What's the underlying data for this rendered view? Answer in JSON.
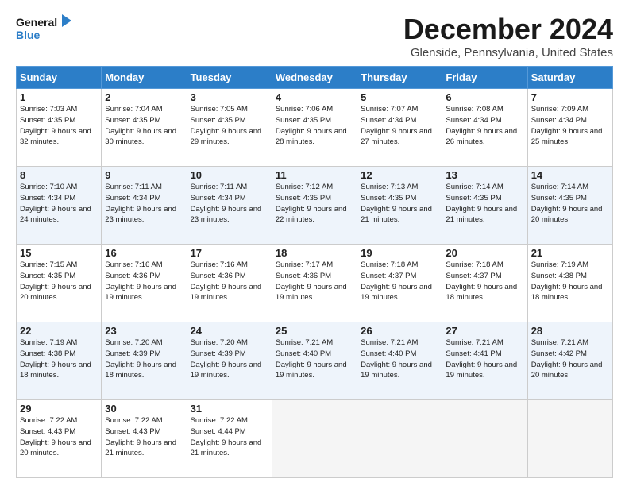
{
  "logo": {
    "line1": "General",
    "line2": "Blue"
  },
  "title": "December 2024",
  "subtitle": "Glenside, Pennsylvania, United States",
  "days_header": [
    "Sunday",
    "Monday",
    "Tuesday",
    "Wednesday",
    "Thursday",
    "Friday",
    "Saturday"
  ],
  "weeks": [
    [
      {
        "day": "1",
        "sunrise": "7:03 AM",
        "sunset": "4:35 PM",
        "daylight": "9 hours and 32 minutes."
      },
      {
        "day": "2",
        "sunrise": "7:04 AM",
        "sunset": "4:35 PM",
        "daylight": "9 hours and 30 minutes."
      },
      {
        "day": "3",
        "sunrise": "7:05 AM",
        "sunset": "4:35 PM",
        "daylight": "9 hours and 29 minutes."
      },
      {
        "day": "4",
        "sunrise": "7:06 AM",
        "sunset": "4:35 PM",
        "daylight": "9 hours and 28 minutes."
      },
      {
        "day": "5",
        "sunrise": "7:07 AM",
        "sunset": "4:34 PM",
        "daylight": "9 hours and 27 minutes."
      },
      {
        "day": "6",
        "sunrise": "7:08 AM",
        "sunset": "4:34 PM",
        "daylight": "9 hours and 26 minutes."
      },
      {
        "day": "7",
        "sunrise": "7:09 AM",
        "sunset": "4:34 PM",
        "daylight": "9 hours and 25 minutes."
      }
    ],
    [
      {
        "day": "8",
        "sunrise": "7:10 AM",
        "sunset": "4:34 PM",
        "daylight": "9 hours and 24 minutes."
      },
      {
        "day": "9",
        "sunrise": "7:11 AM",
        "sunset": "4:34 PM",
        "daylight": "9 hours and 23 minutes."
      },
      {
        "day": "10",
        "sunrise": "7:11 AM",
        "sunset": "4:34 PM",
        "daylight": "9 hours and 23 minutes."
      },
      {
        "day": "11",
        "sunrise": "7:12 AM",
        "sunset": "4:35 PM",
        "daylight": "9 hours and 22 minutes."
      },
      {
        "day": "12",
        "sunrise": "7:13 AM",
        "sunset": "4:35 PM",
        "daylight": "9 hours and 21 minutes."
      },
      {
        "day": "13",
        "sunrise": "7:14 AM",
        "sunset": "4:35 PM",
        "daylight": "9 hours and 21 minutes."
      },
      {
        "day": "14",
        "sunrise": "7:14 AM",
        "sunset": "4:35 PM",
        "daylight": "9 hours and 20 minutes."
      }
    ],
    [
      {
        "day": "15",
        "sunrise": "7:15 AM",
        "sunset": "4:35 PM",
        "daylight": "9 hours and 20 minutes."
      },
      {
        "day": "16",
        "sunrise": "7:16 AM",
        "sunset": "4:36 PM",
        "daylight": "9 hours and 19 minutes."
      },
      {
        "day": "17",
        "sunrise": "7:16 AM",
        "sunset": "4:36 PM",
        "daylight": "9 hours and 19 minutes."
      },
      {
        "day": "18",
        "sunrise": "7:17 AM",
        "sunset": "4:36 PM",
        "daylight": "9 hours and 19 minutes."
      },
      {
        "day": "19",
        "sunrise": "7:18 AM",
        "sunset": "4:37 PM",
        "daylight": "9 hours and 19 minutes."
      },
      {
        "day": "20",
        "sunrise": "7:18 AM",
        "sunset": "4:37 PM",
        "daylight": "9 hours and 18 minutes."
      },
      {
        "day": "21",
        "sunrise": "7:19 AM",
        "sunset": "4:38 PM",
        "daylight": "9 hours and 18 minutes."
      }
    ],
    [
      {
        "day": "22",
        "sunrise": "7:19 AM",
        "sunset": "4:38 PM",
        "daylight": "9 hours and 18 minutes."
      },
      {
        "day": "23",
        "sunrise": "7:20 AM",
        "sunset": "4:39 PM",
        "daylight": "9 hours and 18 minutes."
      },
      {
        "day": "24",
        "sunrise": "7:20 AM",
        "sunset": "4:39 PM",
        "daylight": "9 hours and 19 minutes."
      },
      {
        "day": "25",
        "sunrise": "7:21 AM",
        "sunset": "4:40 PM",
        "daylight": "9 hours and 19 minutes."
      },
      {
        "day": "26",
        "sunrise": "7:21 AM",
        "sunset": "4:40 PM",
        "daylight": "9 hours and 19 minutes."
      },
      {
        "day": "27",
        "sunrise": "7:21 AM",
        "sunset": "4:41 PM",
        "daylight": "9 hours and 19 minutes."
      },
      {
        "day": "28",
        "sunrise": "7:21 AM",
        "sunset": "4:42 PM",
        "daylight": "9 hours and 20 minutes."
      }
    ],
    [
      {
        "day": "29",
        "sunrise": "7:22 AM",
        "sunset": "4:43 PM",
        "daylight": "9 hours and 20 minutes."
      },
      {
        "day": "30",
        "sunrise": "7:22 AM",
        "sunset": "4:43 PM",
        "daylight": "9 hours and 21 minutes."
      },
      {
        "day": "31",
        "sunrise": "7:22 AM",
        "sunset": "4:44 PM",
        "daylight": "9 hours and 21 minutes."
      },
      null,
      null,
      null,
      null
    ]
  ],
  "labels": {
    "sunrise": "Sunrise:",
    "sunset": "Sunset:",
    "daylight": "Daylight:"
  }
}
